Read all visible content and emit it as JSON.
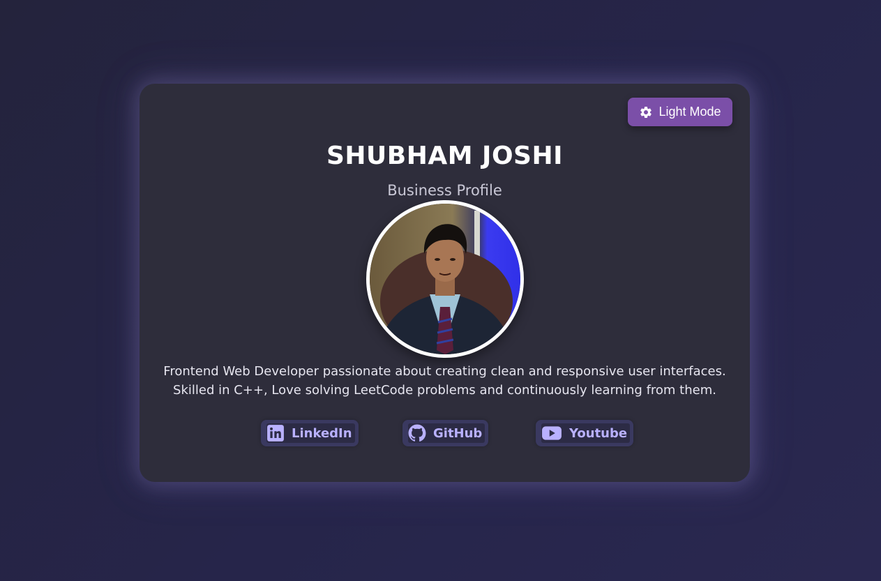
{
  "theme_toggle": {
    "label": "Light Mode",
    "icon": "gear-icon"
  },
  "profile": {
    "name": "SHUBHAM JOSHI",
    "subtitle": "Business Profile",
    "bio_line1": "Frontend Web Developer passionate about creating clean and responsive user interfaces.",
    "bio_line2": "Skilled in C++, Love solving LeetCode problems and continuously learning from them."
  },
  "socials": [
    {
      "label": "LinkedIn",
      "icon": "linkedin-icon"
    },
    {
      "label": "GitHub",
      "icon": "github-icon"
    },
    {
      "label": "Youtube",
      "icon": "youtube-icon"
    }
  ],
  "colors": {
    "background": "#25243f",
    "card": "#2e2d3b",
    "accent": "#7b4fa8",
    "social_text": "#b9b1ff"
  }
}
